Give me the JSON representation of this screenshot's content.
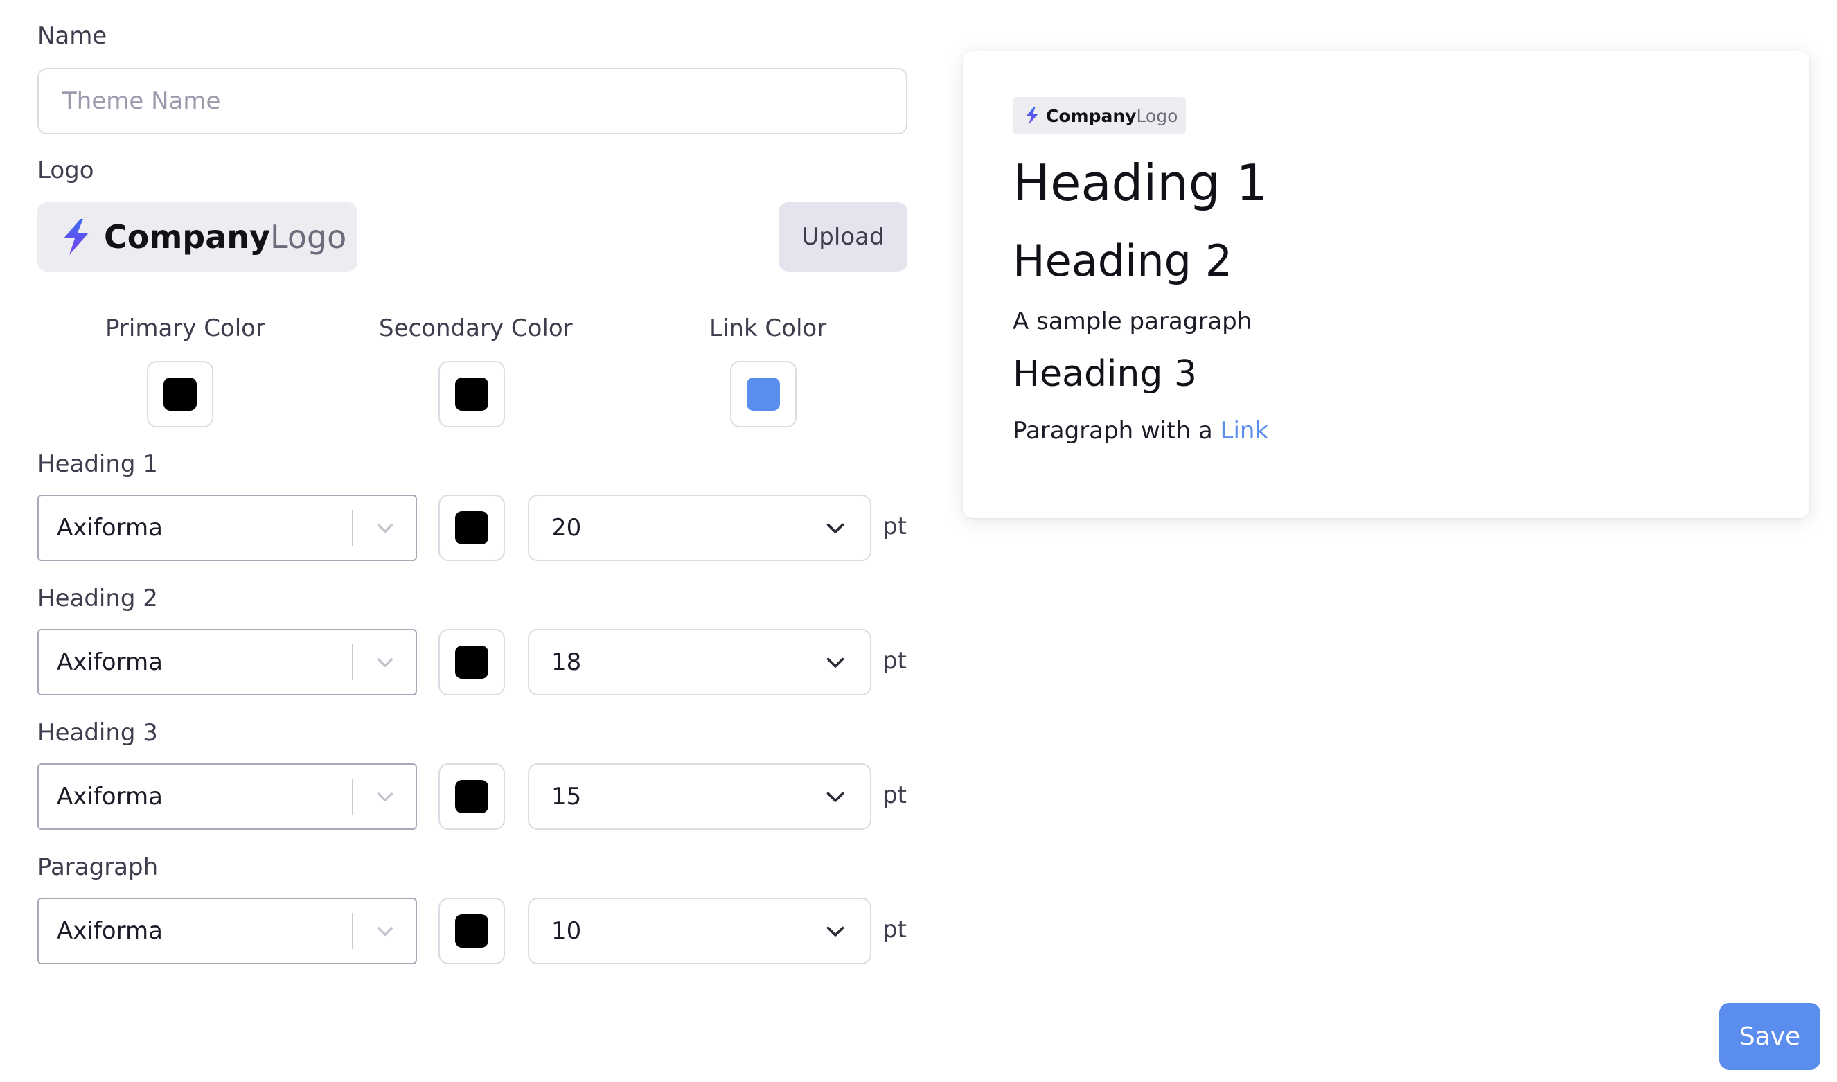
{
  "colors": {
    "primary": "#000000",
    "secondary": "#000000",
    "link": "#5b8def",
    "save_button": "#5b8def",
    "logo_bolt_top": "#3b6cf0",
    "logo_bolt_bottom": "#7b3ff2"
  },
  "form": {
    "name_label": "Name",
    "name_placeholder": "Theme Name",
    "name_value": "",
    "logo_label": "Logo",
    "logo_text_bold": "Company",
    "logo_text_light": "Logo",
    "logo_icon": "lightning-bolt-icon",
    "upload_label": "Upload",
    "color_labels": {
      "primary": "Primary Color",
      "secondary": "Secondary Color",
      "link": "Link Color"
    },
    "typography": [
      {
        "label": "Heading 1",
        "font": "Axiforma",
        "color": "#000000",
        "size": "20",
        "unit": "pt"
      },
      {
        "label": "Heading 2",
        "font": "Axiforma",
        "color": "#000000",
        "size": "18",
        "unit": "pt"
      },
      {
        "label": "Heading 3",
        "font": "Axiforma",
        "color": "#000000",
        "size": "15",
        "unit": "pt"
      },
      {
        "label": "Paragraph",
        "font": "Axiforma",
        "color": "#000000",
        "size": "10",
        "unit": "pt"
      }
    ]
  },
  "preview": {
    "logo_text_bold": "Company",
    "logo_text_light": "Logo",
    "heading1": "Heading 1",
    "heading2": "Heading 2",
    "paragraph1": "A sample paragraph",
    "heading3": "Heading 3",
    "paragraph2_text": "Paragraph with a",
    "paragraph2_link": "Link"
  },
  "actions": {
    "save_label": "Save"
  }
}
